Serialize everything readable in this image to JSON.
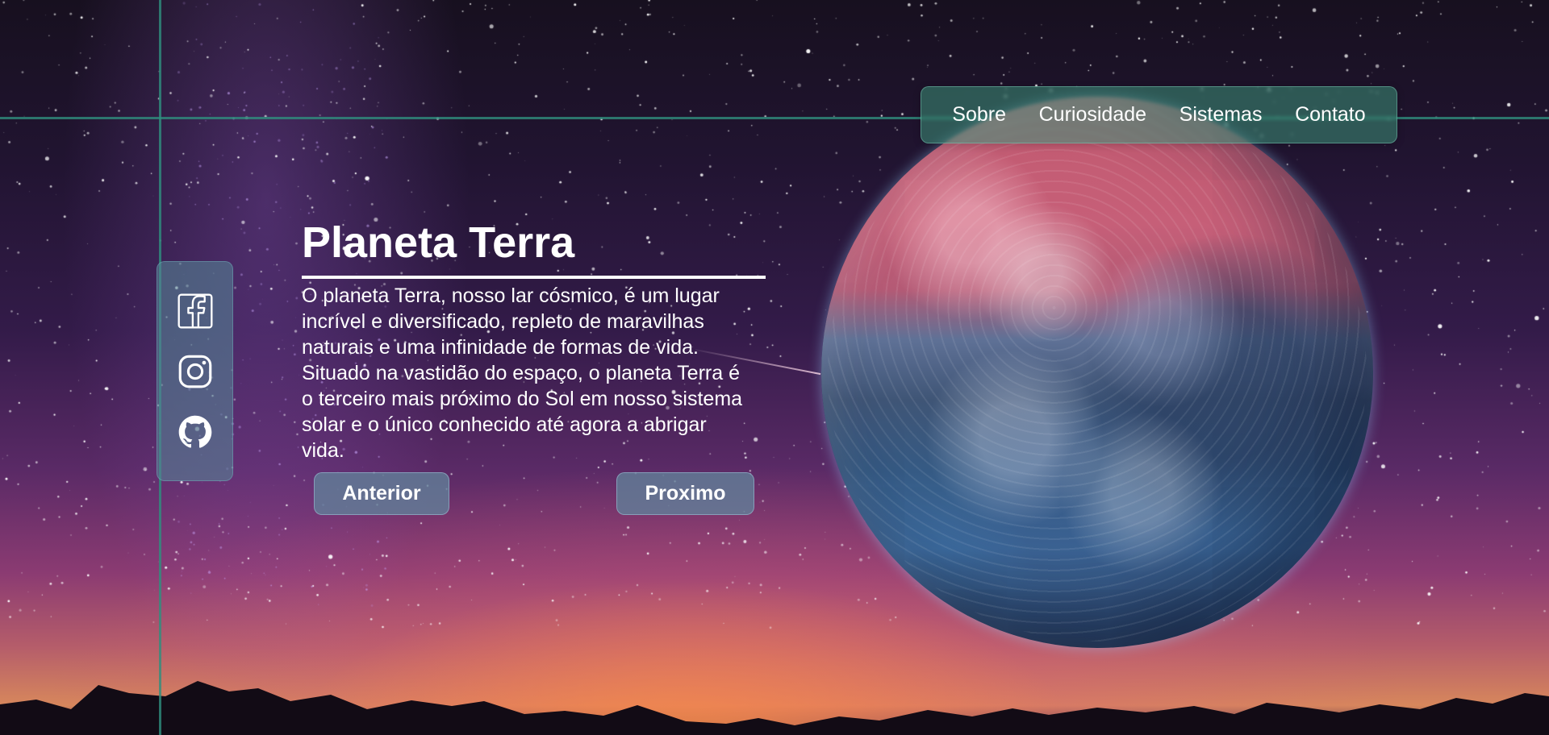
{
  "page": {
    "title": "Planeta Terra",
    "description": "O planeta Terra, nosso lar cósmico, é um lugar incrível e diversificado, repleto de maravilhas naturais e uma infinidade de formas de vida. Situado na vastidão do espaço, o planeta Terra é o terceiro mais próximo do Sol em nosso sistema solar e o único conhecido até agora a abrigar vida."
  },
  "nav": {
    "items": [
      {
        "label": "Sobre"
      },
      {
        "label": "Curiosidade"
      },
      {
        "label": "Sistemas"
      },
      {
        "label": "Contato"
      }
    ]
  },
  "social": {
    "items": [
      {
        "icon": "facebook-icon"
      },
      {
        "icon": "instagram-icon"
      },
      {
        "icon": "github-icon"
      }
    ]
  },
  "buttons": {
    "previous": "Anterior",
    "next": "Proximo"
  },
  "colors": {
    "nav_accent": "#3d9178",
    "grid_line": "#2f8f7e",
    "text": "#ffffff",
    "button_bg": "#61829a"
  }
}
